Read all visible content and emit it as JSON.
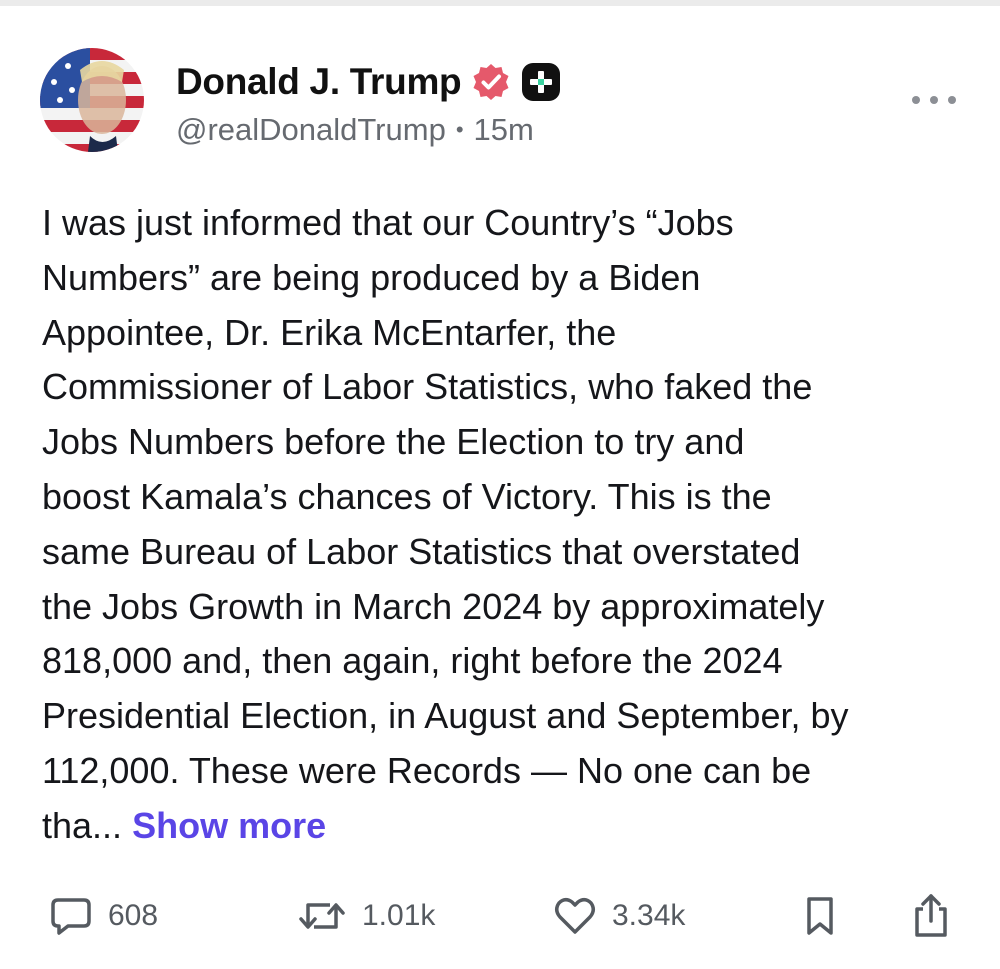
{
  "post": {
    "author": {
      "display_name": "Donald J. Trump",
      "handle": "@realDonaldTrump",
      "time_ago": "15m",
      "separator": "•",
      "verified_badge_color": "#e5596b",
      "secondary_badge_color": "#111111"
    },
    "text": "I was just informed that our Country’s “Jobs\nNumbers” are being produced by a Biden\nAppointee, Dr. Erika McEntarfer, the\nCommissioner of Labor Statistics, who faked the\nJobs Numbers before the Election to try and\nboost Kamala’s chances of Victory. This is the\nsame Bureau of Labor Statistics that overstated\nthe Jobs Growth in March 2024 by approximately\n818,000 and, then again, right before the 2024\nPresidential Election, in August and September, by\n112,000. These were Records — No one can be\ntha...",
    "show_more_label": "Show more",
    "accent_color": "#5a45e6",
    "actions": {
      "replies": {
        "icon": "comment-icon",
        "count": "608"
      },
      "retruths": {
        "icon": "repost-icon",
        "count": "1.01k"
      },
      "likes": {
        "icon": "heart-icon",
        "count": "3.34k"
      },
      "bookmark": {
        "icon": "bookmark-icon"
      },
      "share": {
        "icon": "share-icon"
      }
    }
  }
}
